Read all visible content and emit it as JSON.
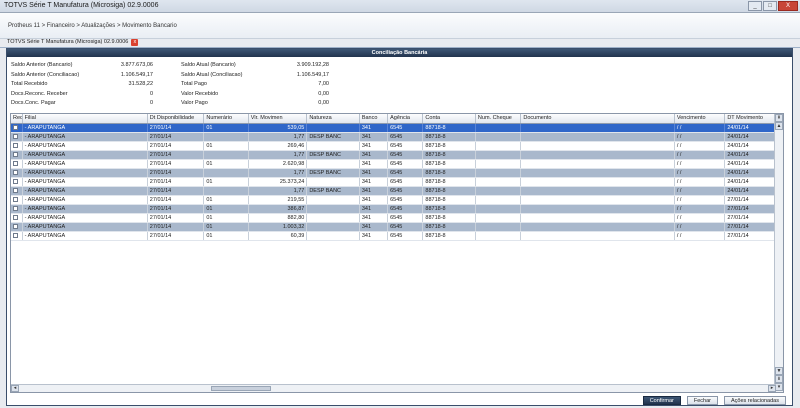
{
  "window": {
    "title": "TOTVS Série T Manufatura (Microsiga) 02.9.0006",
    "min": "_",
    "max": "□",
    "close": "X"
  },
  "breadcrumb": "Protheus 11 > Financeiro > Atualizações > Movimento Bancario",
  "tab": {
    "label": "TOTVS Série T Manufatura (Microsiga) 02.9.0006",
    "close": "x"
  },
  "panel": {
    "title": "Conciliação Bancária"
  },
  "summary": {
    "left": [
      {
        "label": "Saldo Anterior (Bancario)",
        "value": "3.877.673,06"
      },
      {
        "label": "Saldo Anterior (Conciliacao)",
        "value": "1.106.549,17"
      },
      {
        "label": "Total Recebido",
        "value": "31.528,22"
      },
      {
        "label": "Docs.Reconc. Receber",
        "value": "0"
      },
      {
        "label": "Docs.Conc. Pagar",
        "value": "0"
      }
    ],
    "right": [
      {
        "label": "Saldo Atual (Bancario)",
        "value": "3.909.192,28"
      },
      {
        "label": "Saldo Atual (Conciliacao)",
        "value": "1.106.549,17"
      },
      {
        "label": "Total Pago",
        "value": "7,00"
      },
      {
        "label": "Valor Recebido",
        "value": "0,00"
      },
      {
        "label": "Valor Pago",
        "value": "0,00"
      }
    ]
  },
  "table": {
    "columns": [
      "Rec",
      "Filial",
      "Dt Disponibilidade",
      "Numerário",
      "Vlr. Movimen",
      "Natureza",
      "Banco",
      "Agência",
      "Conta",
      "Num. Cheque",
      "Documento",
      "Vencimento",
      "DT Movimento"
    ],
    "rows": [
      [
        "",
        "- ARAPUTANGA",
        "27/01/14",
        "01",
        "539,05",
        "",
        "341",
        "6545",
        "88718-8",
        "",
        "",
        "/ /",
        "24/01/14"
      ],
      [
        "",
        "- ARAPUTANGA",
        "27/01/14",
        "",
        "1,77",
        "DESP BANC",
        "341",
        "6545",
        "88718-8",
        "",
        "",
        "/ /",
        "24/01/14"
      ],
      [
        "",
        "- ARAPUTANGA",
        "27/01/14",
        "01",
        "269,46",
        "",
        "341",
        "6545",
        "88718-8",
        "",
        "",
        "/ /",
        "24/01/14"
      ],
      [
        "",
        "- ARAPUTANGA",
        "27/01/14",
        "",
        "1,77",
        "DESP BANC",
        "341",
        "6545",
        "88718-8",
        "",
        "",
        "/ /",
        "24/01/14"
      ],
      [
        "",
        "- ARAPUTANGA",
        "27/01/14",
        "01",
        "2.620,98",
        "",
        "341",
        "6545",
        "88718-8",
        "",
        "",
        "/ /",
        "24/01/14"
      ],
      [
        "",
        "- ARAPUTANGA",
        "27/01/14",
        "",
        "1,77",
        "DESP BANC",
        "341",
        "6545",
        "88718-8",
        "",
        "",
        "/ /",
        "24/01/14"
      ],
      [
        "",
        "- ARAPUTANGA",
        "27/01/14",
        "01",
        "25.373,24",
        "",
        "341",
        "6545",
        "88718-8",
        "",
        "",
        "/ /",
        "24/01/14"
      ],
      [
        "",
        "- ARAPUTANGA",
        "27/01/14",
        "",
        "1,77",
        "DESP BANC",
        "341",
        "6545",
        "88718-8",
        "",
        "",
        "/ /",
        "24/01/14"
      ],
      [
        "",
        "- ARAPUTANGA",
        "27/01/14",
        "01",
        "219,55",
        "",
        "341",
        "6545",
        "88718-8",
        "",
        "",
        "/ /",
        "27/01/14"
      ],
      [
        "",
        "- ARAPUTANGA",
        "27/01/14",
        "01",
        "386,87",
        "",
        "341",
        "6545",
        "88718-8",
        "",
        "",
        "/ /",
        "27/01/14"
      ],
      [
        "",
        "- ARAPUTANGA",
        "27/01/14",
        "01",
        "882,80",
        "",
        "341",
        "6545",
        "88718-8",
        "",
        "",
        "/ /",
        "27/01/14"
      ],
      [
        "",
        "- ARAPUTANGA",
        "27/01/14",
        "01",
        "1.003,32",
        "",
        "341",
        "6545",
        "88718-8",
        "",
        "",
        "/ /",
        "27/01/14"
      ],
      [
        "",
        "- ARAPUTANGA",
        "27/01/14",
        "01",
        "60,39",
        "",
        "341",
        "6545",
        "88718-8",
        "",
        "",
        "/ /",
        "27/01/14"
      ]
    ]
  },
  "footer": {
    "confirm": "Confirmar",
    "cancel": "Fechar",
    "actions": "Ações relacionadas"
  },
  "colors": {
    "selected_row": "#2f66c9",
    "alt_row": "#a9b8cc",
    "header_dark": "#22344e"
  }
}
